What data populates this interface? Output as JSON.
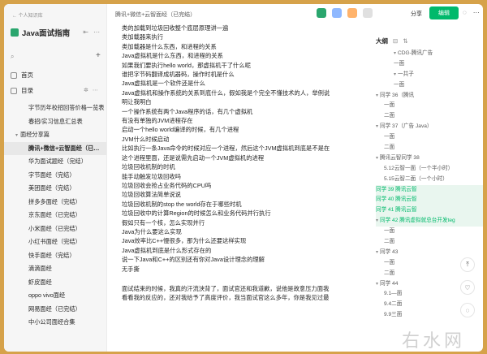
{
  "sidebar": {
    "crumb": "← 个人知识库",
    "title": "Java面试指南",
    "nav": [
      {
        "label": "首页"
      },
      {
        "label": "目录"
      }
    ],
    "tree": [
      {
        "label": "字节历年校招回答价格一览表",
        "level": 1,
        "arrow": ""
      },
      {
        "label": "春招/实习信息汇总表",
        "level": 1,
        "arrow": ""
      },
      {
        "label": "面经分享篇",
        "level": 0,
        "arrow": "▾"
      },
      {
        "label": "腾讯+微信+云智面经（已…",
        "level": 1,
        "arrow": "",
        "active": true
      },
      {
        "label": "华为面试题经（完结）",
        "level": 1,
        "arrow": ""
      },
      {
        "label": "字节面经（完结）",
        "level": 1,
        "arrow": ""
      },
      {
        "label": "美团面经（完结）",
        "level": 1,
        "arrow": ""
      },
      {
        "label": "拼多多面经（完结）",
        "level": 1,
        "arrow": ""
      },
      {
        "label": "京东面经（已完结）",
        "level": 1,
        "arrow": ""
      },
      {
        "label": "小米面经（已完结）",
        "level": 1,
        "arrow": ""
      },
      {
        "label": "小红书面经（完结）",
        "level": 1,
        "arrow": ""
      },
      {
        "label": "快手面经（完结）",
        "level": 1,
        "arrow": ""
      },
      {
        "label": "滴滴面经",
        "level": 1,
        "arrow": ""
      },
      {
        "label": "虾皮面经",
        "level": 1,
        "arrow": ""
      },
      {
        "label": "oppo vivo面经",
        "level": 1,
        "arrow": ""
      },
      {
        "label": "网易面经（已完结）",
        "level": 1,
        "arrow": ""
      },
      {
        "label": "中小公司面经合集",
        "level": 1,
        "arrow": ""
      }
    ]
  },
  "topbar": {
    "path": "腾讯+微信+云智面经（已完结）",
    "share": "分享",
    "edit": "编辑"
  },
  "content": {
    "lines": [
      "类的加载到垃圾回收整个底层原理讲一遍",
      "类加载器来执行",
      "类加载器是什么东西，和进程的关系",
      "Java虚拟机是什么东西，和进程的关系",
      "如果我们要执行hello world，那虚拟机干了什么呢",
      "谁把字节码翻译成机器码，操作时机是什么",
      "Java虚拟机是一个软件还是什么",
      "Java虚拟机和操作系统的关系到底什么，假如我是个完全不懂技术的人，举例说",
      "明让我明白",
      "一个操作系统有两个Java程序的话，有几个虚拟机",
      "有没有单独的JVM进程存在",
      "启动一个hello world编译的时候，有几个进程",
      "JVM什么时候启动",
      "比如执行一条Java命令的时候对应一个进程，然后这个JVM虚拟机到底是不是在",
      "这个进程里面，还是说需先启动一个JVM虚拟机的进程",
      "垃圾回收机制的时机",
      "能手动触发垃圾回收吗",
      "垃圾回收会抢占业务代码的CPU吗",
      "垃圾回收算法简单说说",
      "垃圾回收机制的stop the world存在于哪些时机",
      "垃圾回收中的计算Region的时候怎么和业务代码并行执行",
      "假如只有一个核，怎么实现并行",
      "Java为什么要这么实现",
      "Java效率比C++慢很多，那为什么还要这样实现",
      "Java虚拟机到底是什么形式存在的",
      "说一下Java和C++的区别还有你对Java设计理念的理解",
      "无手撕",
      "",
      "面试结束的时候，我真的汗流浃背了，面试官还和我道歉，说他是故意压力面我",
      "看看我的反应的，还对我给予了高度评价，我当面试官这么多年，你是我见过最"
    ]
  },
  "outline": {
    "head": "大纲",
    "items": [
      {
        "label": "CDG-腾讯广告",
        "lvl": 3,
        "arrow": "▾"
      },
      {
        "label": "一面",
        "lvl": 3,
        "arrow": ""
      },
      {
        "label": "一共子",
        "lvl": 3,
        "arrow": "▾"
      },
      {
        "label": "一面",
        "lvl": 3,
        "arrow": ""
      },
      {
        "label": "同学 36（腾讯",
        "lvl": 1,
        "arrow": "▾"
      },
      {
        "label": "一面",
        "lvl": 2,
        "arrow": ""
      },
      {
        "label": "二面",
        "lvl": 2,
        "arrow": ""
      },
      {
        "label": "同学 37（广告 Java）",
        "lvl": 1,
        "arrow": "▾"
      },
      {
        "label": "一面",
        "lvl": 2,
        "arrow": ""
      },
      {
        "label": "二面",
        "lvl": 2,
        "arrow": ""
      },
      {
        "label": "腾讯云智同学 38",
        "lvl": 1,
        "arrow": "▾"
      },
      {
        "label": "5.12云智一面（一个半小时）",
        "lvl": 2,
        "arrow": ""
      },
      {
        "label": "5.15云智二面（一个小时）",
        "lvl": 2,
        "arrow": ""
      },
      {
        "label": "同学 39 腾讯云智",
        "lvl": 1,
        "arrow": "",
        "hl": true
      },
      {
        "label": "同学 40 腾讯云智",
        "lvl": 1,
        "arrow": "",
        "hl": true
      },
      {
        "label": "同学 41 腾讯云智",
        "lvl": 1,
        "arrow": "",
        "hl": true
      },
      {
        "label": "同学 42 腾讯虚拟就总台开发teg",
        "lvl": 1,
        "arrow": "▾",
        "hl": true
      },
      {
        "label": "一面",
        "lvl": 2,
        "arrow": ""
      },
      {
        "label": "二面",
        "lvl": 2,
        "arrow": ""
      },
      {
        "label": "同学 43",
        "lvl": 1,
        "arrow": "▾"
      },
      {
        "label": "一面",
        "lvl": 2,
        "arrow": ""
      },
      {
        "label": "二面",
        "lvl": 2,
        "arrow": ""
      },
      {
        "label": "同学 44",
        "lvl": 1,
        "arrow": "▾"
      },
      {
        "label": "9.1—面",
        "lvl": 2,
        "arrow": ""
      },
      {
        "label": "9.4二面",
        "lvl": 2,
        "arrow": ""
      },
      {
        "label": "9.9三面",
        "lvl": 2,
        "arrow": ""
      }
    ]
  },
  "watermark": "右水网"
}
